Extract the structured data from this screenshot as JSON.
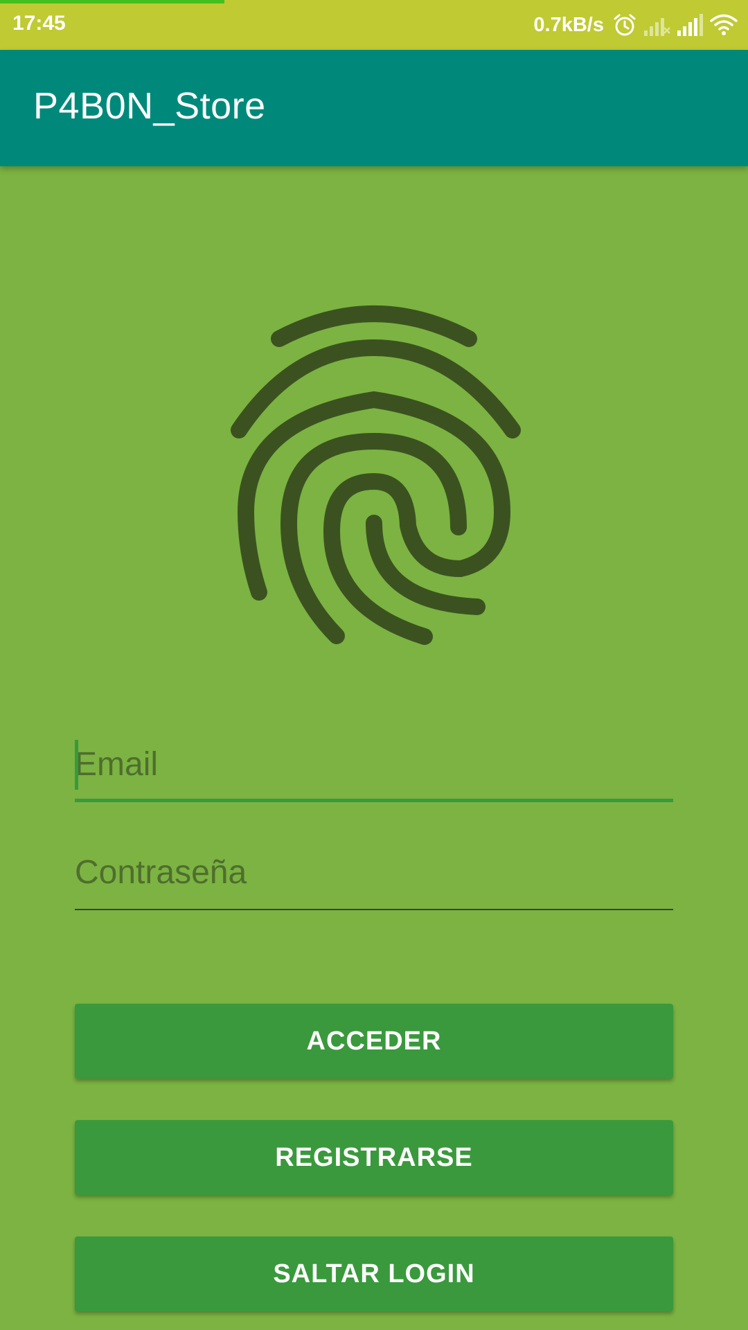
{
  "status_bar": {
    "time": "17:45",
    "net_speed": "0.7kB/s",
    "page_load_progress": 0.3,
    "icons": [
      "alarm-icon",
      "signal-none-icon",
      "signal-icon",
      "wifi-icon"
    ],
    "color": "#c0ca33"
  },
  "app_bar": {
    "title": "P4B0N_Store",
    "color": "#00897b"
  },
  "login": {
    "icon": "fingerprint-icon",
    "email_placeholder": "Email",
    "password_placeholder": "Contraseña"
  },
  "buttons": {
    "login_label": "ACCEDER",
    "register_label": "REGISTRARSE",
    "skip_label": "SALTAR LOGIN"
  },
  "colors": {
    "background": "#7cb342",
    "button": "#3a993c",
    "fingerprint": "#3b5220"
  }
}
